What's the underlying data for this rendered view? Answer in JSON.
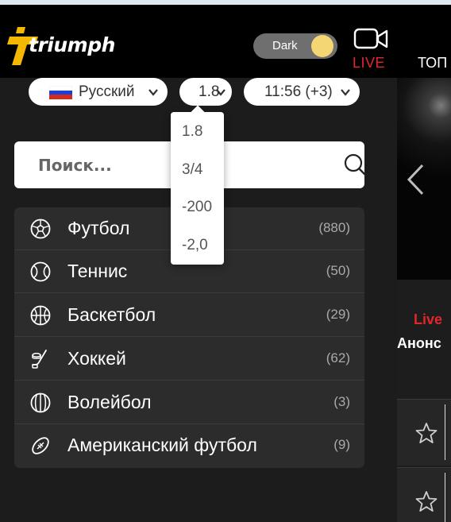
{
  "header": {
    "logo_text": "triumph",
    "theme_toggle_label": "Dark",
    "live_label": "LIVE",
    "top_nav_label": "ТОП"
  },
  "controls": {
    "language": "Русский",
    "odds_format": "1.8",
    "time": "11:56 (+3)"
  },
  "odds_dropdown": {
    "options": [
      "1.8",
      "3/4",
      "-200",
      "-2,0"
    ]
  },
  "search": {
    "placeholder": "Поиск..."
  },
  "sports": [
    {
      "name": "Футбол",
      "count": "(880)",
      "icon": "football-icon"
    },
    {
      "name": "Теннис",
      "count": "(50)",
      "icon": "tennis-icon"
    },
    {
      "name": "Баскетбол",
      "count": "(29)",
      "icon": "basketball-icon"
    },
    {
      "name": "Хоккей",
      "count": "(62)",
      "icon": "hockey-icon"
    },
    {
      "name": "Волейбол",
      "count": "(3)",
      "icon": "volleyball-icon"
    },
    {
      "name": "Американский футбол",
      "count": "(9)",
      "icon": "american-football-icon"
    }
  ],
  "side": {
    "live_label": "Live",
    "anons_label": "Анонс"
  },
  "colors": {
    "accent_live": "#e2262c",
    "logo_yellow": "#f5b800",
    "toggle_knob": "#f4d774",
    "background": "#1c1c1c"
  }
}
